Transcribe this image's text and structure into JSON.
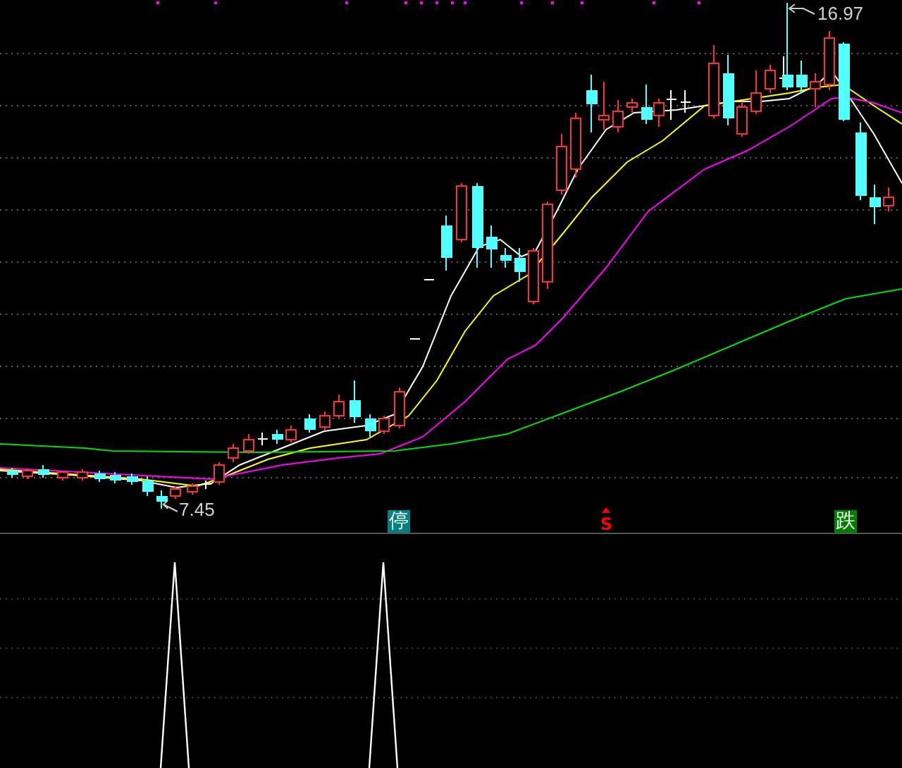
{
  "price_chart": {
    "high_label": "16.97",
    "low_label": "7.45",
    "signals": [
      {
        "label": "停",
        "kind": "badge",
        "color": "#008080"
      },
      {
        "label": "S",
        "kind": "arrow",
        "color": "#ff0000"
      },
      {
        "label": "跌",
        "kind": "badge",
        "color": "#008000"
      }
    ]
  }
}
